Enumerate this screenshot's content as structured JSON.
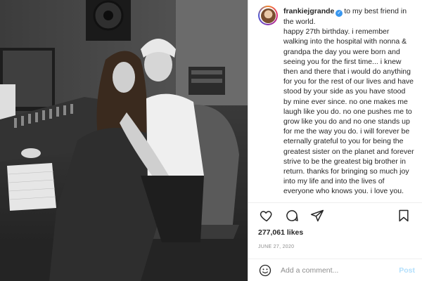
{
  "post": {
    "username": "frankiejgrande",
    "verified": true,
    "caption": "to my best friend in the world.",
    "caption_body": "happy 27th birthday. i remember walking into the hospital with nonna & grandpa the day you were born and seeing you for the first time... i knew then and there that i would do anything for you for the rest of our lives and have stood by your side as you have stood by mine ever since. no one makes me laugh like you do. no one pushes me to grow like you do and no one stands up for me the way you do. i will forever be eternally grateful to you for being the greatest sister on the planet and forever strive to be the greatest big brother in return. thanks for bringing so much joy into my life and into the lives of everyone who knows you. i love you.",
    "likes": "277,061 likes",
    "date": "JUNE 27, 2020"
  },
  "comment": {
    "placeholder": "Add a comment...",
    "post_label": "Post"
  },
  "icons": {
    "like": "heart-icon",
    "comment": "comment-icon",
    "share": "paper-plane-icon",
    "save": "bookmark-icon",
    "emoji": "smiley-icon",
    "verified": "verified-badge-icon"
  },
  "colors": {
    "accent": "#3897f0",
    "post_disabled": "#b2dffc",
    "text": "#262626",
    "muted": "#8e8e8e"
  }
}
